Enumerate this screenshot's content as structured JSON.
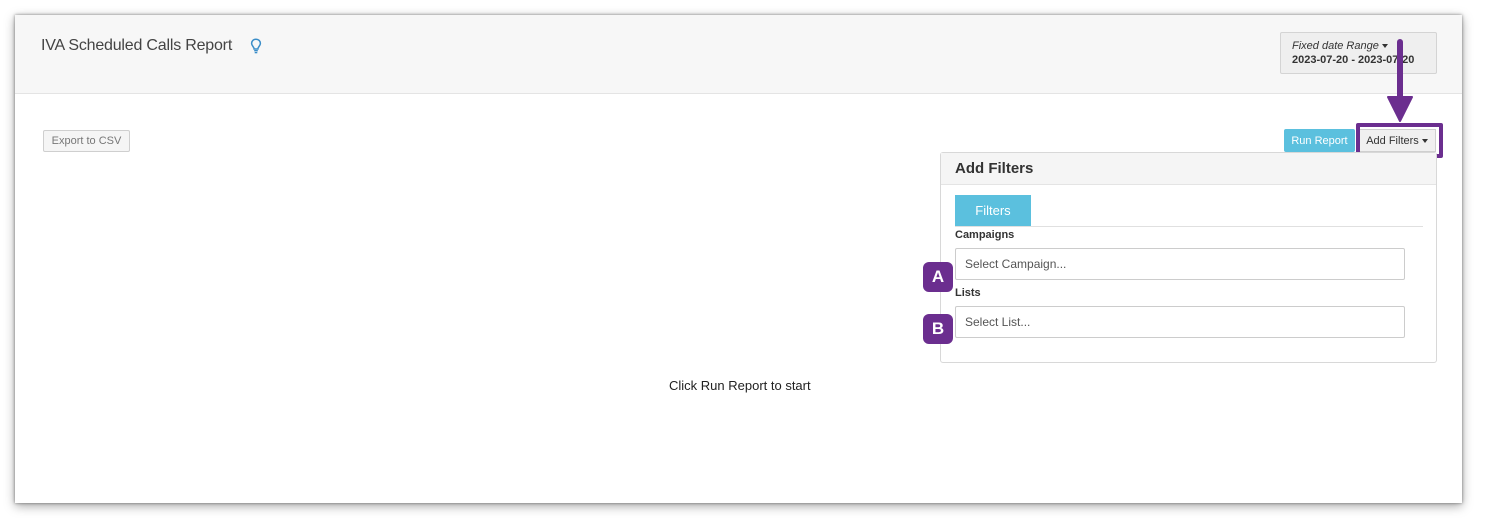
{
  "header": {
    "title": "IVA Scheduled Calls Report",
    "date_range": {
      "label": "Fixed date Range",
      "value": "2023-07-20 - 2023-07-20"
    }
  },
  "toolbar": {
    "export_label": "Export to CSV",
    "run_label": "Run Report",
    "add_filters_label": "Add Filters"
  },
  "filters_panel": {
    "title": "Add Filters",
    "tab_label": "Filters",
    "campaigns": {
      "label": "Campaigns",
      "placeholder": "Select Campaign..."
    },
    "lists": {
      "label": "Lists",
      "placeholder": "Select List..."
    }
  },
  "annotations": {
    "badge_a": "A",
    "badge_b": "B"
  },
  "main": {
    "empty_message": "Click Run Report to start"
  },
  "colors": {
    "accent": "#5bc0de",
    "annotation": "#6b2e8f"
  }
}
